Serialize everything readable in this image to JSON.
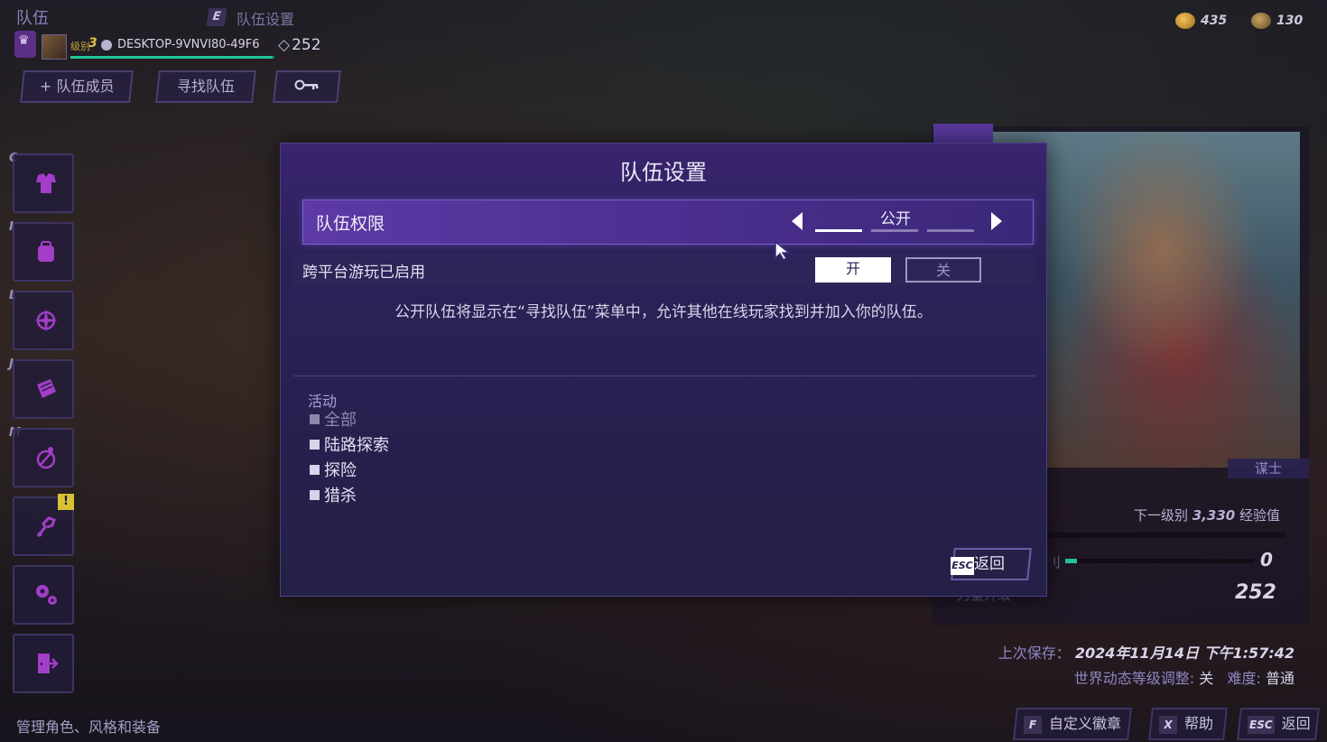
{
  "header": {
    "title": "队伍",
    "sub_key": "E",
    "sub_title": "队伍设置"
  },
  "player": {
    "level_label": "级别",
    "level": "3",
    "name": "DESKTOP-9VNVI80-49F6",
    "points": "252",
    "xp_progress": 0.99
  },
  "top_buttons": {
    "add_member": "+ 队伍成员",
    "find_team": "寻找队伍",
    "key_icon": "key-icon"
  },
  "currency": {
    "gold": "435",
    "other": "130"
  },
  "sidebar": {
    "items": [
      {
        "key": "C",
        "icon": "armor-icon"
      },
      {
        "key": "I",
        "icon": "backpack-icon"
      },
      {
        "key": "L",
        "icon": "compass-icon"
      },
      {
        "key": "J",
        "icon": "journal-icon"
      },
      {
        "key": "M",
        "icon": "map-icon"
      },
      {
        "key": "",
        "icon": "skill-tree-icon",
        "alert": "!"
      },
      {
        "key": "",
        "icon": "settings-icon"
      },
      {
        "key": "",
        "icon": "exit-icon"
      }
    ]
  },
  "footer_hint": "管理角色、风格和装备",
  "character": {
    "class_name": "谋士",
    "next_level_label": "下一级别",
    "next_level_xp": "3,330",
    "xp_unit": "经验值",
    "level_value": "0",
    "points_value": "252",
    "partial_label_1": "刂",
    "partial_label_2": "力量升级",
    "progress": 0.06
  },
  "save_info": {
    "last_saved_label": "上次保存：",
    "last_saved_value": "2024年11月14日 下午1:57:42",
    "world_level_label": "世界动态等级调整:",
    "world_level_value": "关",
    "difficulty_label": "难度:",
    "difficulty_value": "普通"
  },
  "bottom_buttons": {
    "customize_key": "F",
    "customize_label": "自定义徽章",
    "help_key": "X",
    "help_label": "帮助",
    "back_key": "ESC",
    "back_label": "返回"
  },
  "modal": {
    "title": "队伍设置",
    "permission_label": "队伍权限",
    "permission_value": "公开",
    "crossplay_label": "跨平台游玩已启用",
    "toggle_on": "开",
    "toggle_off": "关",
    "description": "公开队伍将显示在“寻找队伍”菜单中，允许其他在线玩家找到并加入你的队伍。",
    "activity_title": "活动",
    "activities": [
      "全部",
      "陆路探索",
      "探险",
      "猎杀"
    ],
    "back_key": "ESC",
    "back_label": "返回"
  }
}
